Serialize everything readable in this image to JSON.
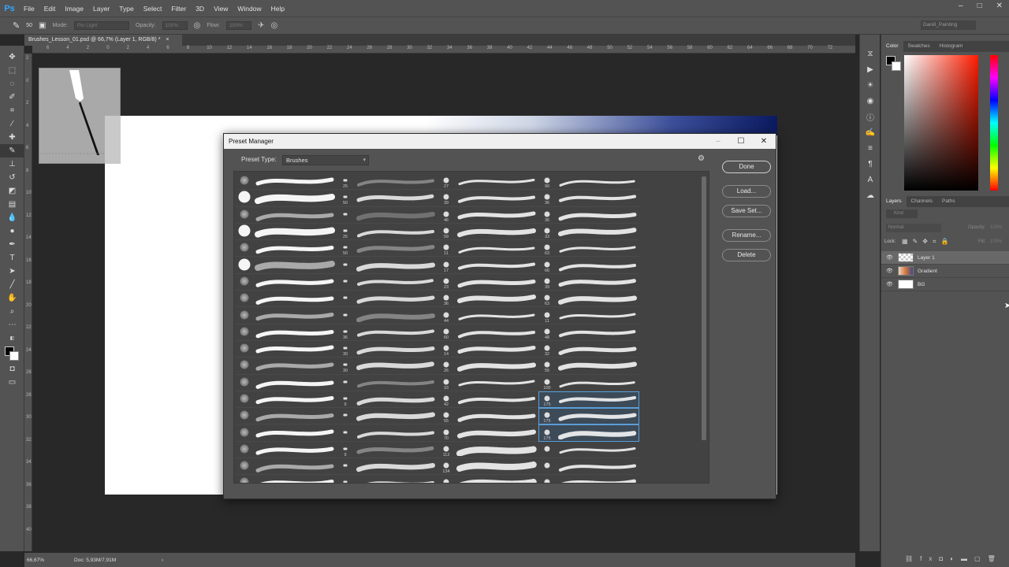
{
  "app": {
    "logo": "Ps",
    "menu": [
      "File",
      "Edit",
      "Image",
      "Layer",
      "Type",
      "Select",
      "Filter",
      "3D",
      "View",
      "Window",
      "Help"
    ],
    "window_controls": [
      "–",
      "□",
      "✕"
    ]
  },
  "options_bar": {
    "size": "50",
    "mode_label": "Mode:",
    "mode_value": "Pin Light",
    "opacity_label": "Opacity:",
    "opacity_value": "100%",
    "flow_label": "Flow:",
    "flow_value": "100%",
    "workspace": "Daniil_Painting"
  },
  "document": {
    "tab_label": "Brushes_Lesson_01.psd @ 66,7% (Layer 1, RGB/8) *",
    "tab_close": "×"
  },
  "ruler": {
    "top": [
      "6",
      "4",
      "2",
      "0",
      "2",
      "4",
      "6",
      "8",
      "10",
      "12",
      "14",
      "16",
      "18",
      "20",
      "22",
      "24",
      "26",
      "28",
      "30",
      "32",
      "34",
      "36",
      "38",
      "40",
      "42",
      "44",
      "46",
      "48",
      "50",
      "52",
      "54",
      "56",
      "58",
      "60",
      "62",
      "64",
      "66",
      "68",
      "70",
      "72"
    ],
    "left": [
      "2",
      "0",
      "2",
      "4",
      "6",
      "8",
      "10",
      "12",
      "14",
      "16",
      "18",
      "20",
      "22",
      "24",
      "26",
      "28",
      "30",
      "32",
      "34",
      "36",
      "38",
      "40"
    ]
  },
  "status_bar": {
    "zoom": "66,67%",
    "doc_size": "Doc: 5,93M/7,91M",
    "arrow": "›"
  },
  "dialog": {
    "title": "Preset Manager",
    "preset_type_label": "Preset Type:",
    "preset_type_value": "Brushes",
    "buttons": {
      "done": "Done",
      "load": "Load...",
      "save_set": "Save Set...",
      "rename": "Rename...",
      "delete": "Delete"
    },
    "columns": [
      {
        "sizes": [
          "",
          "",
          "",
          "",
          "",
          "",
          "",
          "",
          "",
          "",
          "",
          "",
          "",
          "",
          "",
          "",
          "",
          "",
          ""
        ],
        "kind": "round"
      },
      {
        "sizes": [
          "25",
          "50",
          "",
          "25",
          "50",
          "",
          "",
          "",
          "",
          "36",
          "30",
          "30",
          "",
          "9",
          "",
          "",
          "9",
          "",
          ""
        ],
        "kind": "tip"
      },
      {
        "sizes": [
          "27",
          "39",
          "46",
          "59",
          "11",
          "17",
          "23",
          "36",
          "44",
          "60",
          "14",
          "26",
          "33",
          "42",
          "55",
          "70",
          "112",
          "134",
          ""
        ],
        "kind": "tex"
      },
      {
        "sizes": [
          "90",
          "36",
          "36",
          "33",
          "63",
          "66",
          "39",
          "63",
          "11",
          "48",
          "32",
          "55",
          "100",
          "175",
          "175",
          "175",
          "",
          "",
          ""
        ],
        "kind": "tex"
      }
    ]
  },
  "panels": {
    "color_tabs": [
      "Color",
      "Swatches",
      "Histogram"
    ],
    "layers_tabs": [
      "Layers",
      "Channels",
      "Paths"
    ],
    "kind_placeholder": "Kind",
    "blend_mode": "Normal",
    "opacity_label": "Opacity:",
    "opacity_value": "100%",
    "lock_label": "Lock:",
    "fill_label": "Fill:",
    "fill_value": "100%",
    "layers": [
      "Layer 1",
      "Gradient",
      "BG"
    ]
  },
  "colors": {
    "ui_panel": "#535353",
    "ui_dark": "#282828",
    "highlight": "#5a9ed6",
    "ps_blue": "#31a8ff"
  }
}
